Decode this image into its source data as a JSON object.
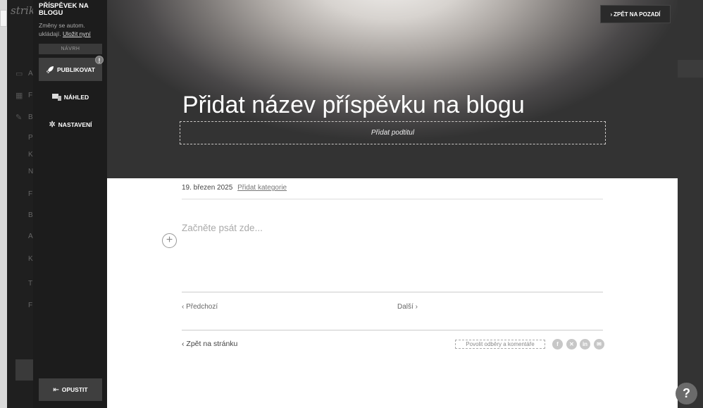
{
  "app": {
    "logo": "strik"
  },
  "bg_sidebar": {
    "icon_labels": [
      "A",
      "F",
      "B",
      "P",
      "K",
      "N",
      "F",
      "B",
      "A",
      "K",
      "T",
      "F"
    ]
  },
  "panel": {
    "title": "PŘÍSPĚVEK NA BLOGU",
    "autosave_note": "Změny se autom. ukládají.",
    "save_now": "Uložit nyní",
    "status_badge": "NÁVRH",
    "publish_label": "PUBLIKOVAT",
    "publish_alert": "!",
    "preview_label": "NÁHLED",
    "settings_label": "NASTAVENÍ",
    "exit_label": "OPUSTIT"
  },
  "hero": {
    "back_to_background": "ZPĚT NA POZADÍ",
    "title": "Přidat název příspěvku na blogu",
    "subtitle_placeholder": "Přidat podtitul"
  },
  "post": {
    "date": "19. březen 2025",
    "add_categories": "Přidat kategorie",
    "body_placeholder": "Začněte psát zde...",
    "previous": "Předchozí",
    "next": "Další",
    "back_to_page": "Zpět na stránku",
    "subscribe": "Povolit odběry a komentáře",
    "social_icons": [
      "facebook-icon",
      "x-icon",
      "linkedin-icon",
      "email-icon"
    ]
  },
  "help": {
    "label": "?"
  }
}
